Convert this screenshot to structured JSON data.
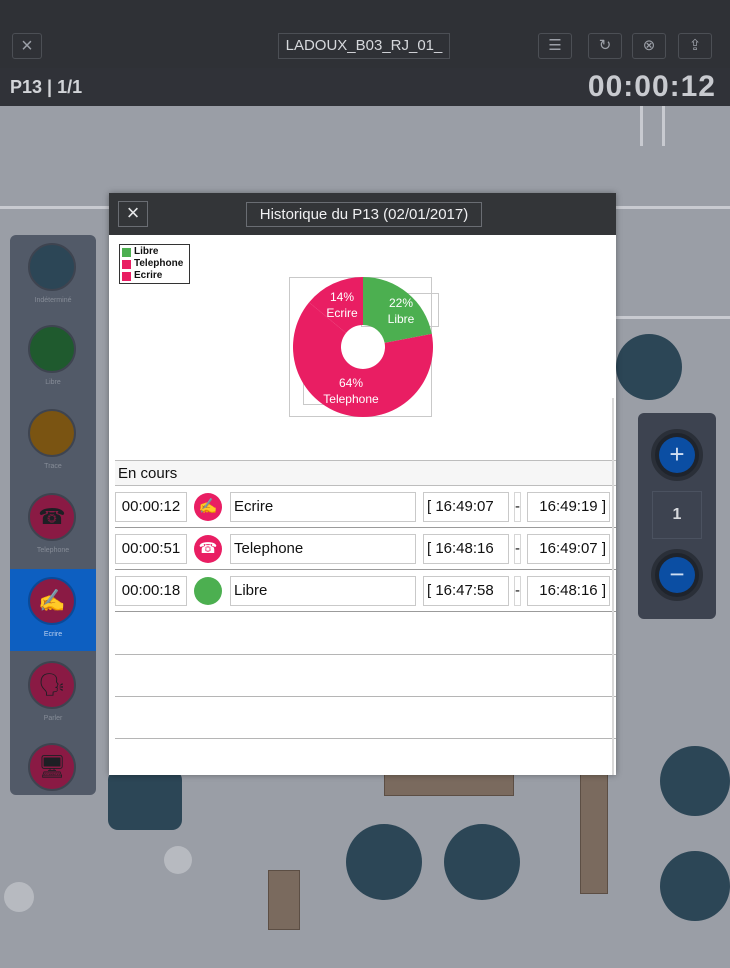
{
  "topbar": {
    "close_label": "×",
    "title": "LADOUX_B03_RJ_01_",
    "buttons": [
      {
        "name": "list-icon",
        "glyph": "☰"
      },
      {
        "name": "history-icon",
        "glyph": "↻"
      },
      {
        "name": "reset-icon",
        "glyph": "⊗"
      },
      {
        "name": "share-icon",
        "glyph": "⇪"
      }
    ]
  },
  "subbar": {
    "position_label": "P13 | 1/1",
    "timer": "00:00:12"
  },
  "palette": {
    "items": [
      {
        "label": "Indéterminé",
        "color": "#2c4656",
        "glyph": ""
      },
      {
        "label": "Libre",
        "color": "#1f5a2e",
        "glyph": ""
      },
      {
        "label": "Trace",
        "color": "#7a5412",
        "glyph": ""
      },
      {
        "label": "Telephone",
        "color": "#8a1a44",
        "glyph": "☎"
      },
      {
        "label": "Ecrire",
        "color": "#8a1a44",
        "glyph": "✍"
      },
      {
        "label": "Parler",
        "color": "#8a1a44",
        "glyph": "🗣"
      },
      {
        "label": "",
        "color": "#8a1a44",
        "glyph": "🖥"
      }
    ]
  },
  "zoom": {
    "plus": "+",
    "value": "1",
    "minus": "−"
  },
  "modal": {
    "close_label": "×",
    "title": "Historique du P13 (02/01/2017)",
    "section_label": "En cours"
  },
  "chart_data": {
    "type": "pie",
    "donut": true,
    "legend_position": "top-left",
    "series": [
      {
        "name": "Libre",
        "percent": 22,
        "label": "22%",
        "sublabel": "Libre",
        "color": "#4caf50"
      },
      {
        "name": "Telephone",
        "percent": 64,
        "label": "64%",
        "sublabel": "Telephone",
        "color": "#e91e63"
      },
      {
        "name": "Ecrire",
        "percent": 14,
        "label": "14%",
        "sublabel": "Ecrire",
        "color": "#e91e63"
      }
    ]
  },
  "history": [
    {
      "duration": "00:00:12",
      "icon": "write-icon",
      "glyph": "✍",
      "color": "#e91e63",
      "name": "Ecrire",
      "start": "[ 16:49:07",
      "sep": "-",
      "end": "16:49:19 ]"
    },
    {
      "duration": "00:00:51",
      "icon": "phone-icon",
      "glyph": "☎",
      "color": "#e91e63",
      "name": "Telephone",
      "start": "[ 16:48:16",
      "sep": "-",
      "end": "16:49:07 ]"
    },
    {
      "duration": "00:00:18",
      "icon": "free-icon",
      "glyph": "",
      "color": "#4caf50",
      "name": "Libre",
      "start": "[ 16:47:58",
      "sep": "-",
      "end": "16:48:16 ]"
    }
  ]
}
